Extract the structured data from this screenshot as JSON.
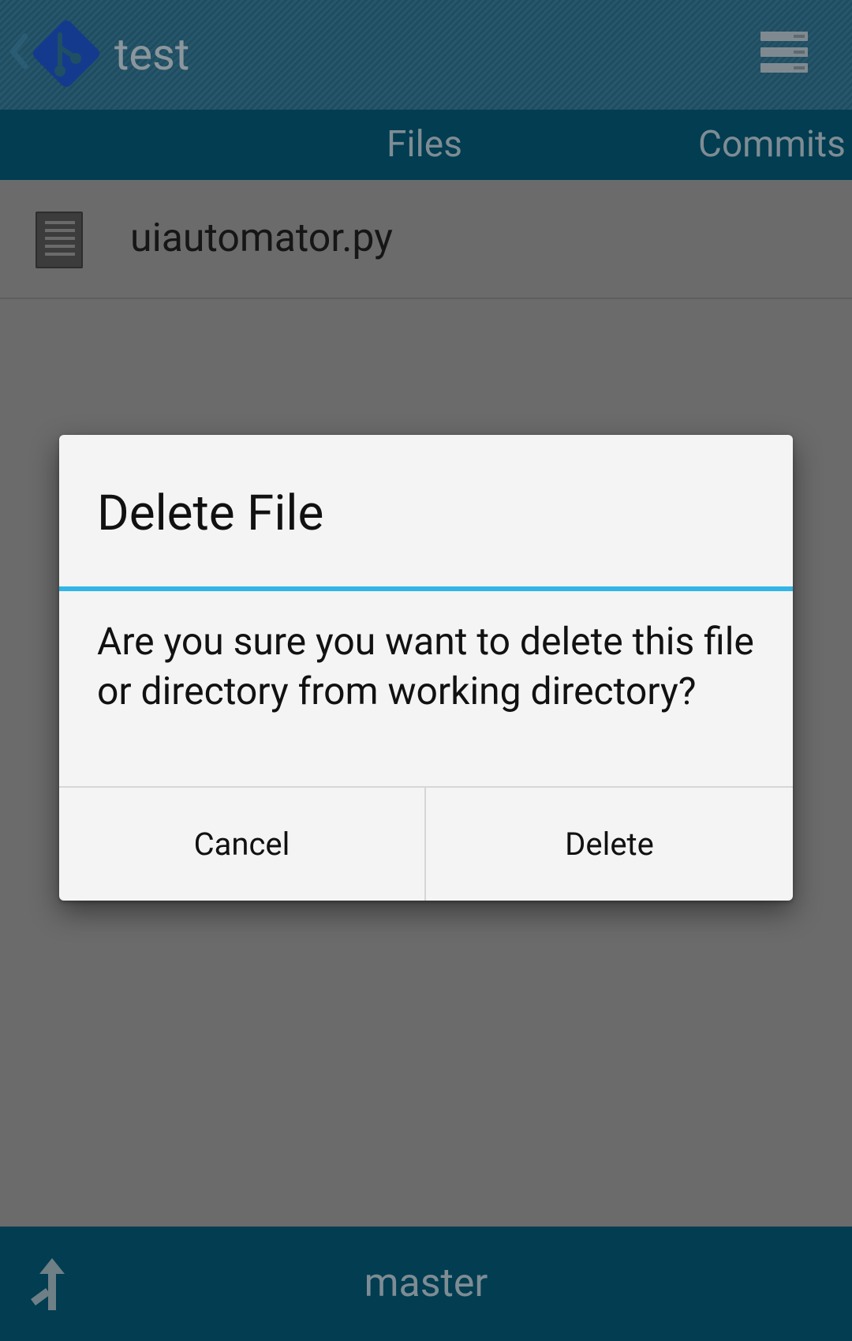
{
  "actionbar": {
    "title": "test",
    "back_icon": "chevron-left-icon",
    "logo_icon": "git-logo-icon",
    "overflow_icon": "overflow-menu-icon"
  },
  "tabs": [
    {
      "label": "Files"
    },
    {
      "label": "Commits"
    }
  ],
  "files": [
    {
      "name": "uiautomator.py",
      "icon": "file-document-icon"
    }
  ],
  "bottombar": {
    "branch": "master",
    "branch_icon": "branch-icon"
  },
  "dialog": {
    "title": "Delete File",
    "message": "Are you sure you want to delete this file or directory from working directory?",
    "cancel_label": "Cancel",
    "delete_label": "Delete",
    "accent_color": "#33b5e5"
  },
  "colors": {
    "actionbar": "#1f4f64",
    "tabbar": "#023d52",
    "scrim_background": "#6b6b6b",
    "dialog_background": "#f4f4f4"
  }
}
